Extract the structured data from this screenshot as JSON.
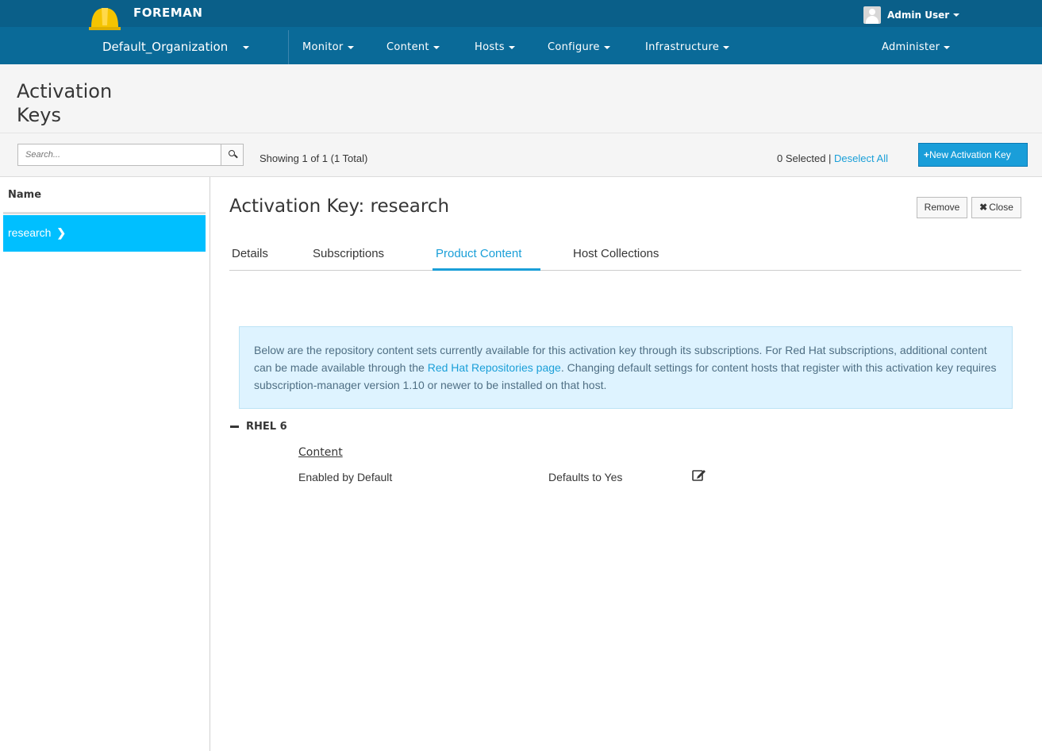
{
  "brand": {
    "name": "FOREMAN"
  },
  "user_menu": {
    "label": "Admin User"
  },
  "nav": {
    "organization": "Default_Organization",
    "items": [
      "Monitor",
      "Content",
      "Hosts",
      "Configure",
      "Infrastructure"
    ],
    "administer": "Administer"
  },
  "page": {
    "title": "Activation Keys"
  },
  "toolbar": {
    "search_placeholder": "Search...",
    "showing": "Showing 1 of 1 (1 Total)",
    "selected": "0 Selected |",
    "deselect": "Deselect All",
    "new_button": "New Activation Key"
  },
  "list": {
    "column_header": "Name",
    "rows": [
      {
        "label": "research"
      }
    ]
  },
  "detail": {
    "title": "Activation Key: research",
    "remove_label": "Remove",
    "close_label": "Close",
    "tabs": [
      {
        "label": "Details",
        "active": false
      },
      {
        "label": "Subscriptions",
        "active": false
      },
      {
        "label": "Product Content",
        "active": true
      },
      {
        "label": "Host Collections",
        "active": false
      }
    ],
    "info": {
      "text_before": "Below are the repository content sets currently available for this activation key through its subscriptions. For Red Hat subscriptions, additional content can be made available through the ",
      "link": "Red Hat Repositories page",
      "text_after": ". Changing default settings for content hosts that register with this activation key requires subscription-manager version 1.10 or newer to be installed on that host."
    },
    "product": {
      "name": "RHEL 6",
      "content_label": "Content",
      "enabled_label": "Enabled by Default",
      "enabled_value": "Defaults to Yes"
    }
  },
  "colors": {
    "nav_bg": "#0a6a98",
    "nav_top_bg": "#0a5f89",
    "accent": "#1a9fd8",
    "selected_row": "#00bfff",
    "info_bg": "#def3ff"
  },
  "icons": [
    "helmet-logo",
    "user-avatar",
    "search-icon",
    "plus-icon",
    "chevron-right-icon",
    "close-x-icon",
    "minus-icon",
    "edit-icon"
  ]
}
